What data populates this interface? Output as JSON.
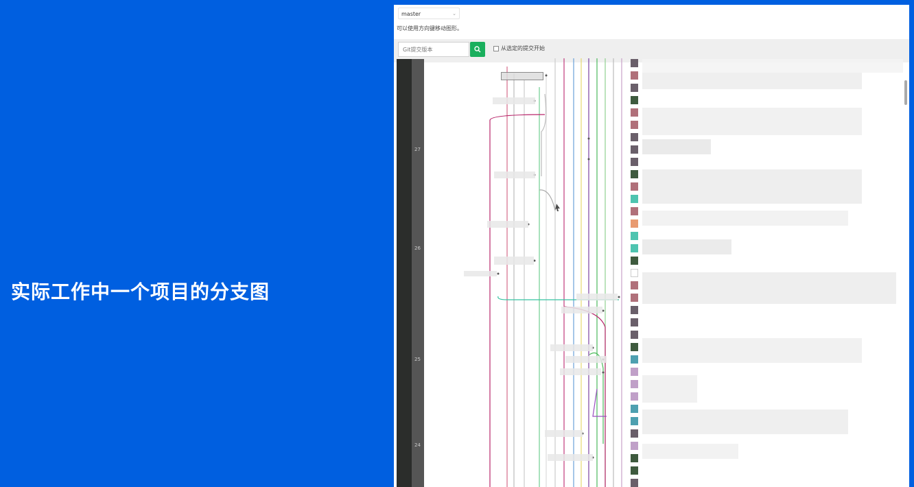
{
  "slide": {
    "title": "实际工作中一个项目的分支图"
  },
  "toolbar": {
    "branch_value": "master",
    "hint": "可以使用方向键移动图形。",
    "search_placeholder": "Git提交版本",
    "checkbox_label": "从选定的提交开始"
  },
  "graph": {
    "rulers": [
      "27",
      "26",
      "25",
      "24"
    ],
    "colors": [
      "#b8256a",
      "#d66a8a",
      "#aaa",
      "#6fcf8f",
      "#7a3fa0",
      "#6aa0d8",
      "#e6d870",
      "#35c2a0",
      "#4ab95a",
      "#9b4dc0"
    ]
  },
  "icons": {
    "search": "search-icon",
    "chevron": "chevron-down-icon",
    "cursor": "mouse-cursor-icon"
  }
}
